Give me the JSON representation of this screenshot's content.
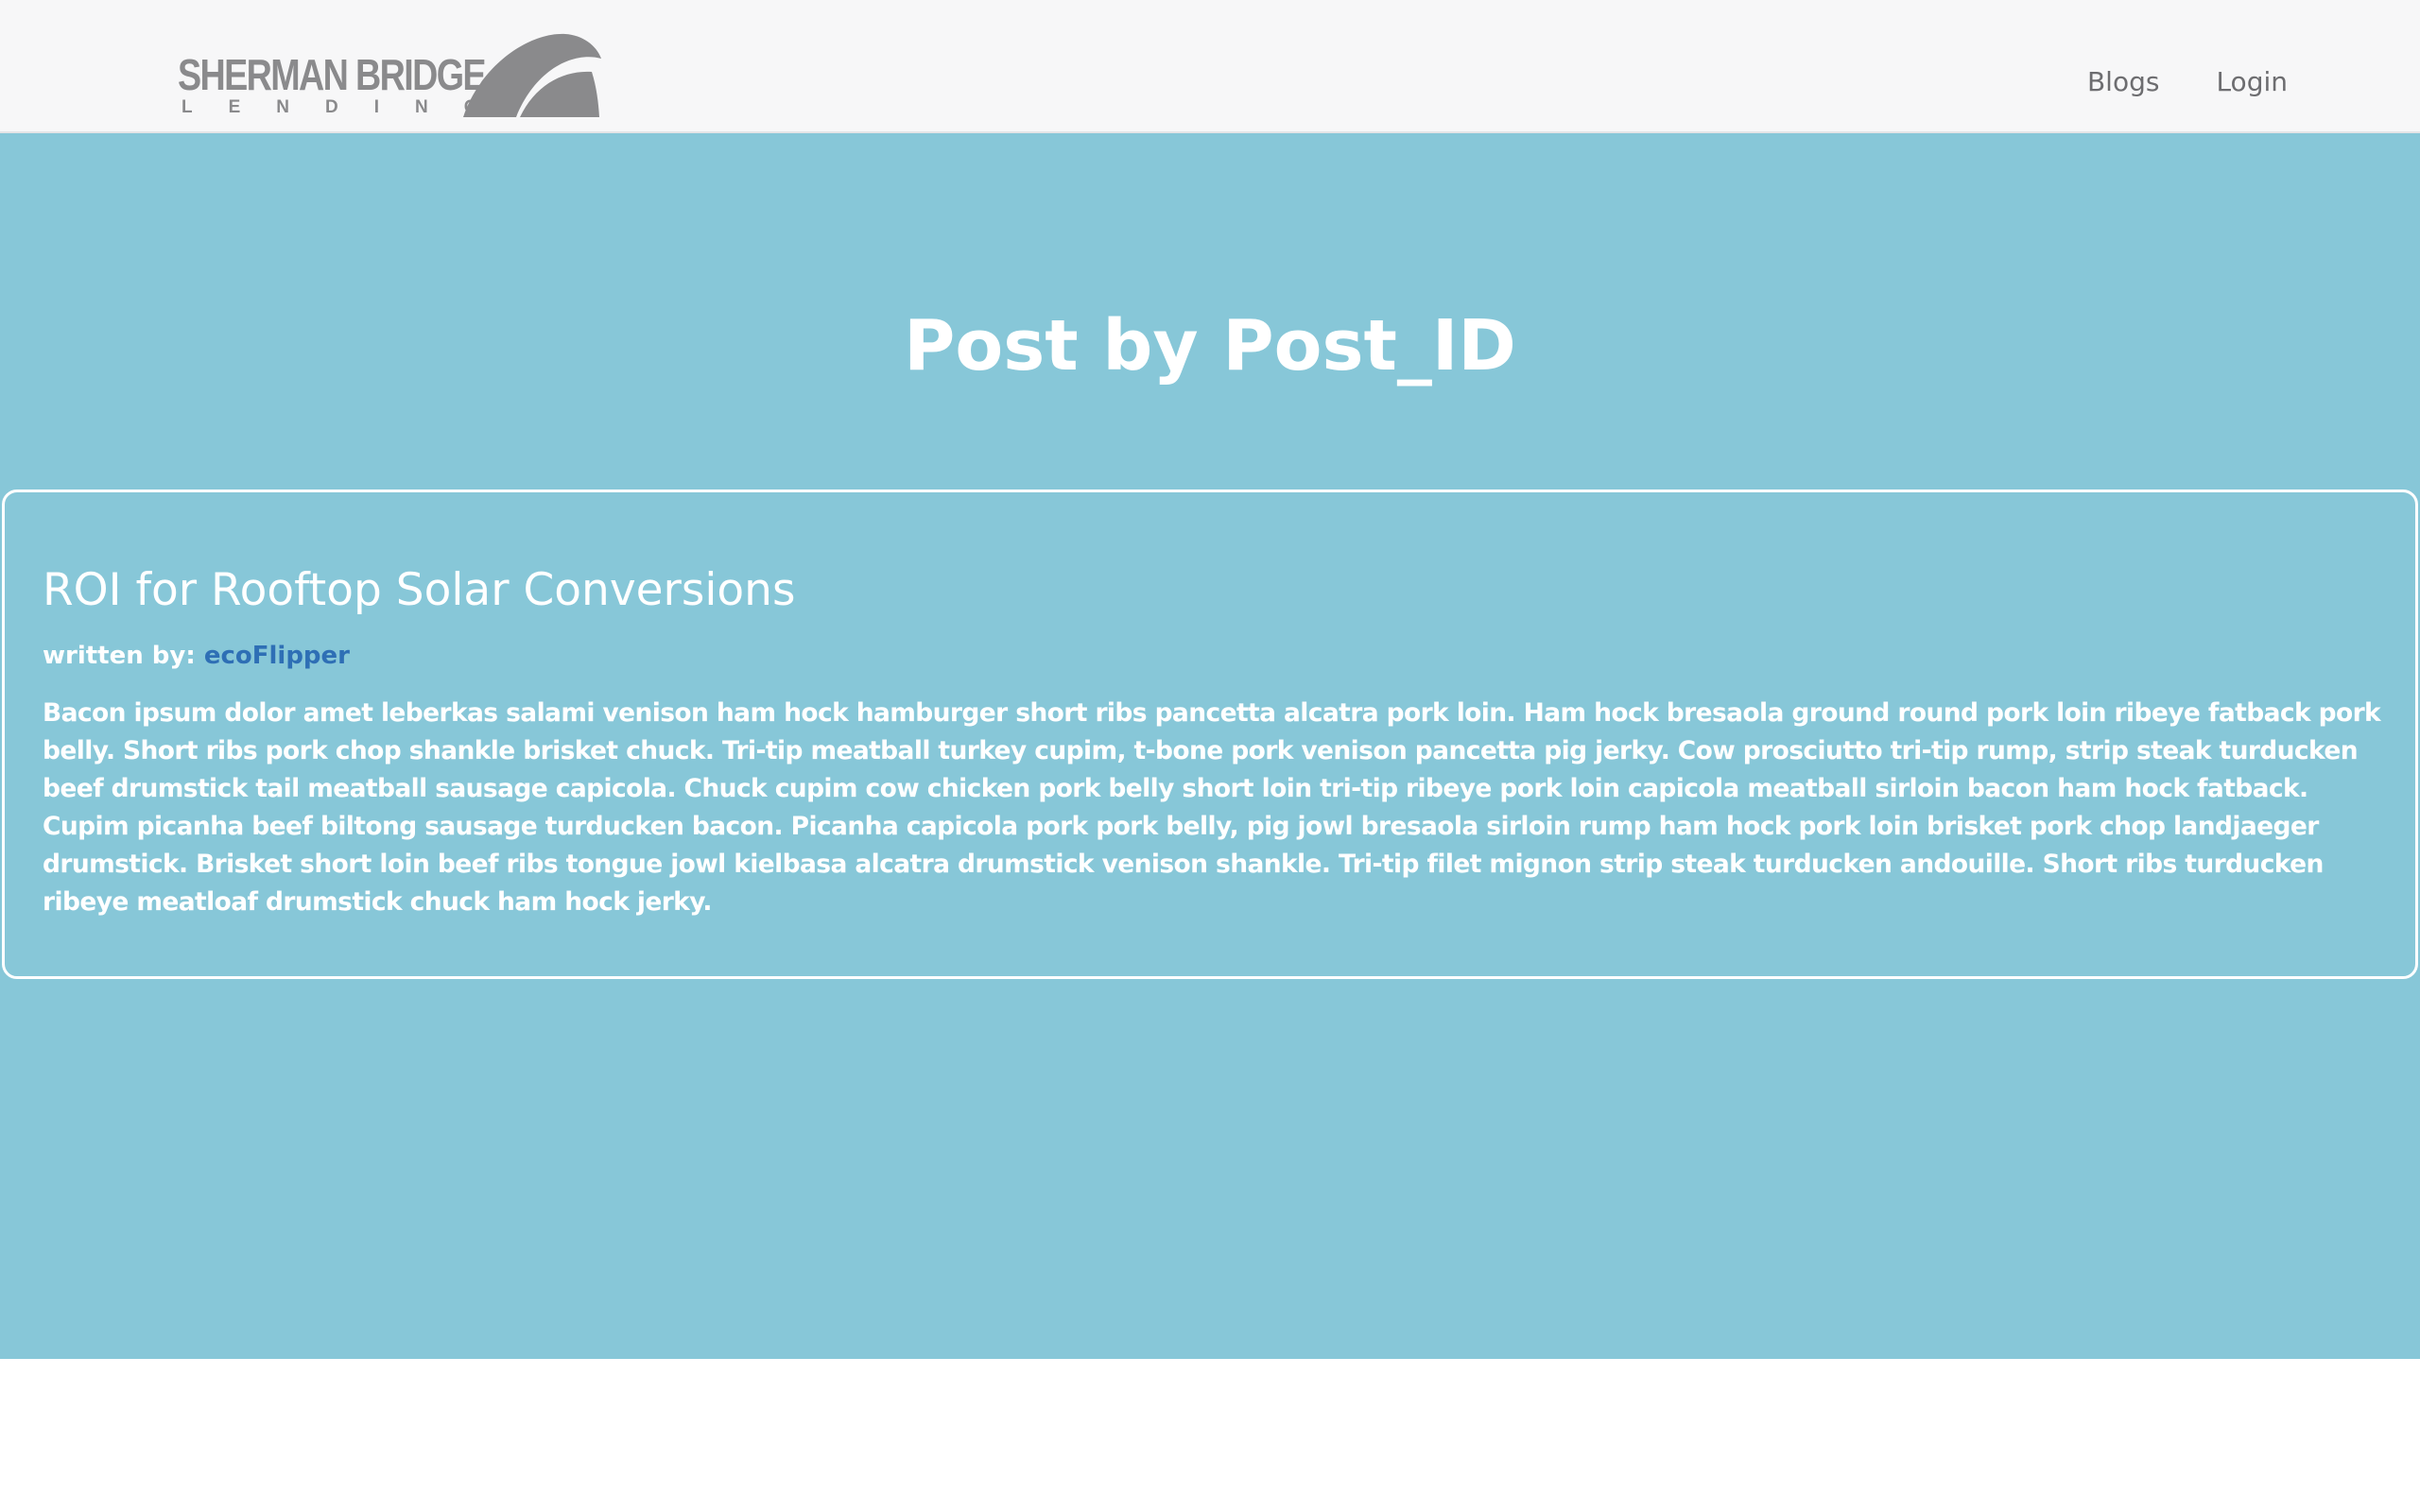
{
  "navbar": {
    "logo": {
      "word": "SHERMAN BRIDGE",
      "sub": "LENDING"
    },
    "links": [
      {
        "label": "Blogs"
      },
      {
        "label": "Login"
      }
    ]
  },
  "hero": {
    "title": "Post by Post_ID"
  },
  "post": {
    "title": "ROI for Rooftop Solar Conversions",
    "byline_label": "written by:",
    "author": "ecoFlipper",
    "body": "Bacon ipsum dolor amet leberkas salami venison ham hock hamburger short ribs pancetta alcatra pork loin. Ham hock bresaola ground round pork loin ribeye fatback pork belly. Short ribs pork chop shankle brisket chuck. Tri-tip meatball turkey cupim, t-bone pork venison pancetta pig jerky. Cow prosciutto tri-tip rump, strip steak turducken beef drumstick tail meatball sausage capicola. Chuck cupim cow chicken pork belly short loin tri-tip ribeye pork loin capicola meatball sirloin bacon ham hock fatback. Cupim picanha beef biltong sausage turducken bacon. Picanha capicola pork pork belly, pig jowl bresaola sirloin rump ham hock pork loin brisket pork chop landjaeger drumstick. Brisket short loin beef ribs tongue jowl kielbasa alcatra drumstick venison shankle. Tri-tip filet mignon strip steak turducken andouille. Short ribs turducken ribeye meatloaf drumstick chuck ham hock jerky."
  },
  "colors": {
    "navbar_bg": "#f7f7f8",
    "hero_bg": "#87c7d8",
    "logo_gray": "#8a8a8c",
    "link_blue": "#2e6fb5",
    "text_white": "#ffffff"
  }
}
